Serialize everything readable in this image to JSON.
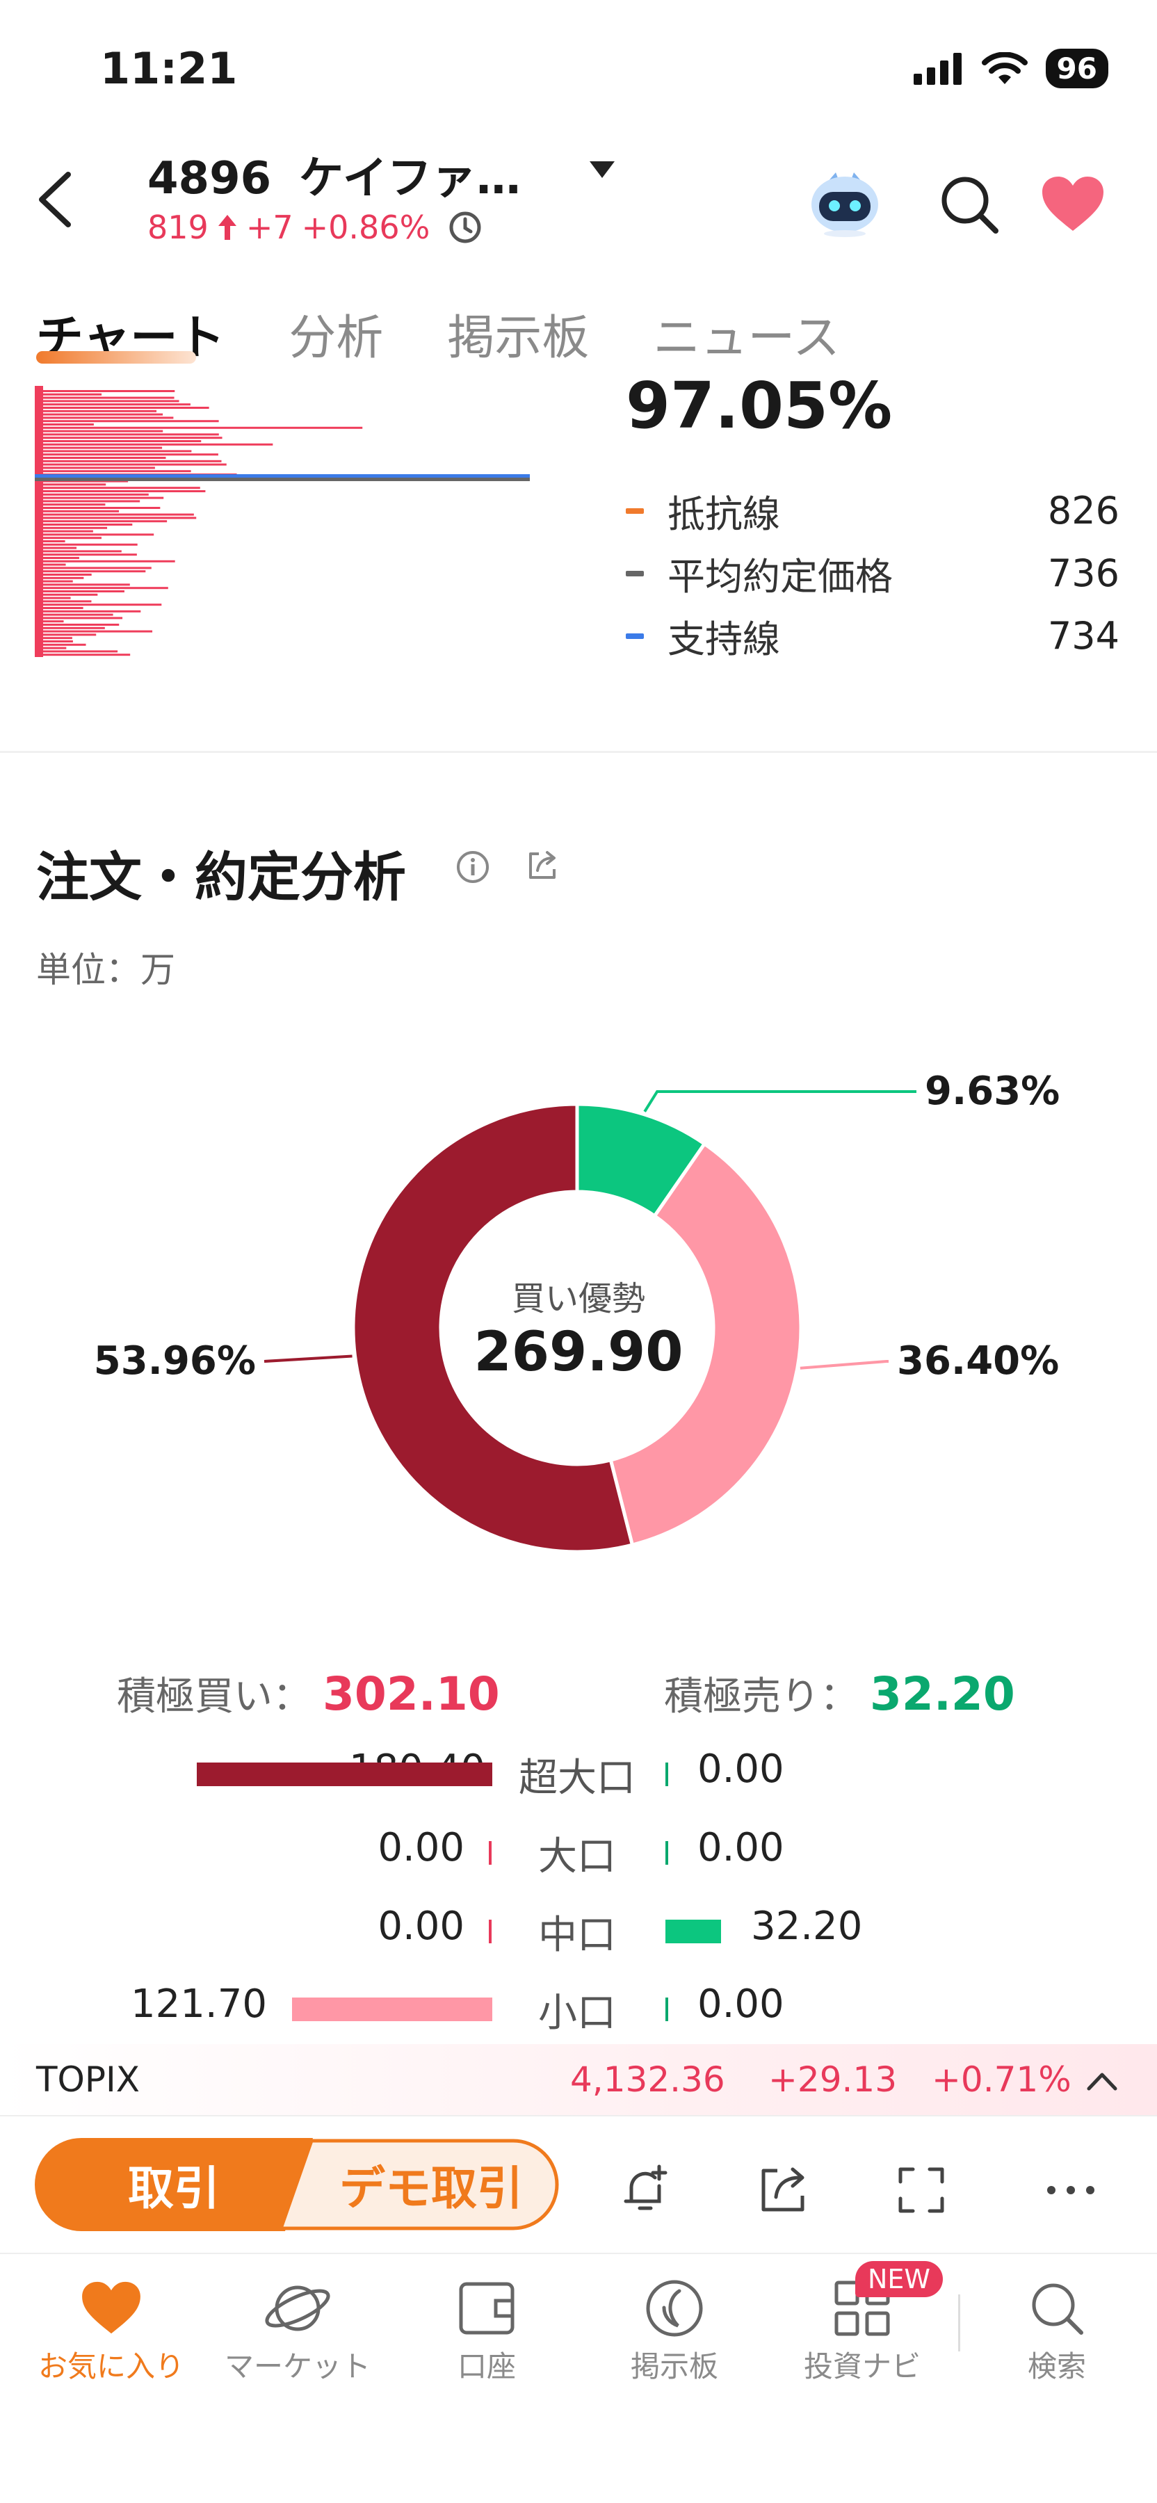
{
  "status": {
    "time": "11:21",
    "battery": "96"
  },
  "header": {
    "code": "4896",
    "name": "ケイファ…",
    "price": "819",
    "change": "+7",
    "change_pct": "+0.86%"
  },
  "tabs": [
    "チャート",
    "分析",
    "掲示板",
    "ニュース"
  ],
  "price_profile": {
    "percent": "97.05%",
    "legend": [
      {
        "label": "抵抗線",
        "value": "826",
        "color": "#f07a2c"
      },
      {
        "label": "平均約定価格",
        "value": "736",
        "color": "#666666"
      },
      {
        "label": "支持線",
        "value": "734",
        "color": "#3b7be8"
      }
    ]
  },
  "order_analysis": {
    "title": "注文・約定分析",
    "unit": "単位：万",
    "center_label": "買い優勢",
    "center_value": "269.90",
    "active_buy_label": "積極買い：",
    "active_buy_value": "302.10",
    "active_sell_label": "積極売り：",
    "active_sell_value": "32.20",
    "sizes": [
      {
        "buy": "180.40",
        "label": "超大口",
        "sell": "0.00"
      },
      {
        "buy": "0.00",
        "label": "大口",
        "sell": "0.00"
      },
      {
        "buy": "0.00",
        "label": "中口",
        "sell": "32.20"
      },
      {
        "buy": "121.70",
        "label": "小口",
        "sell": "0.00"
      }
    ]
  },
  "chart_data": {
    "type": "pie",
    "donut": true,
    "slices": [
      {
        "label": "9.63%",
        "value": 9.63,
        "color": "#0cc67f"
      },
      {
        "label": "36.40%",
        "value": 36.4,
        "color": "#ff97a6"
      },
      {
        "label": "53.96%",
        "value": 53.96,
        "color": "#9c1b2e"
      }
    ],
    "center_label": "買い優勢",
    "center_value": "269.90"
  },
  "index": {
    "name": "TOPIX",
    "value": "4,132.36",
    "change": "+29.13",
    "change_pct": "+0.71%"
  },
  "actions": {
    "trade": "取引",
    "demo": "デモ取引"
  },
  "nav": [
    "お気に入り",
    "マーケット",
    "口座",
    "掲示板",
    "投資ナビ",
    "検索"
  ],
  "badge": "NEW"
}
